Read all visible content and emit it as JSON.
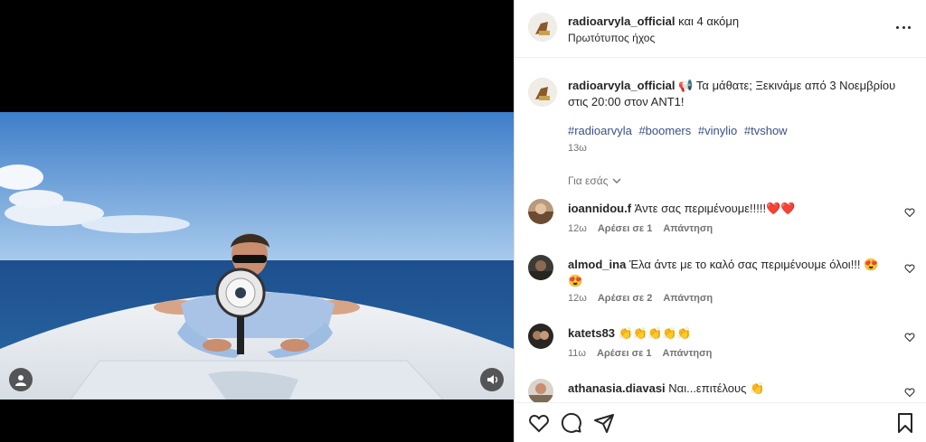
{
  "post": {
    "header_user": "radioarvyla_official",
    "header_coauthors": "και 4 ακόμη",
    "audio_label": "Πρωτότυπος ήχος"
  },
  "caption": {
    "user": "radioarvyla_official",
    "text": "📢 Τα μάθατε; Ξεκινάμε από 3 Νοεμβρίου στις 20:00 στον ΑΝΤ1!",
    "hashtags": [
      "#radioarvyla",
      "#boomers",
      "#vinylio",
      "#tvshow"
    ],
    "time": "13ω"
  },
  "for_you_label": "Για εσάς",
  "comments": [
    {
      "user": "ioannidou.f",
      "text": "Άντε σας περιμένουμε!!!!!❤️❤️",
      "time": "12ω",
      "likes": "Αρέσει σε 1",
      "reply": "Απάντηση"
    },
    {
      "user": "almod_ina",
      "text": "Έλα άντε με το καλό σας περιμένουμε όλοι!!! 😍😍",
      "time": "12ω",
      "likes": "Αρέσει σε 2",
      "reply": "Απάντηση"
    },
    {
      "user": "katets83",
      "text": "👏👏👏👏👏",
      "time": "11ω",
      "likes": "Αρέσει σε 1",
      "reply": "Απάντηση"
    },
    {
      "user": "athanasia.diavasi",
      "text": "Ναι...επιτέλους 👏",
      "time": "",
      "likes": "",
      "reply": ""
    }
  ],
  "icons": {
    "like": "heart-icon",
    "comment": "comment-icon",
    "share": "share-icon",
    "save": "bookmark-icon",
    "more": "more-icon",
    "user_tag": "user-tag-icon",
    "sound": "sound-icon"
  },
  "colors": {
    "hashtag": "#385185",
    "meta": "#737373",
    "text": "#262626"
  }
}
